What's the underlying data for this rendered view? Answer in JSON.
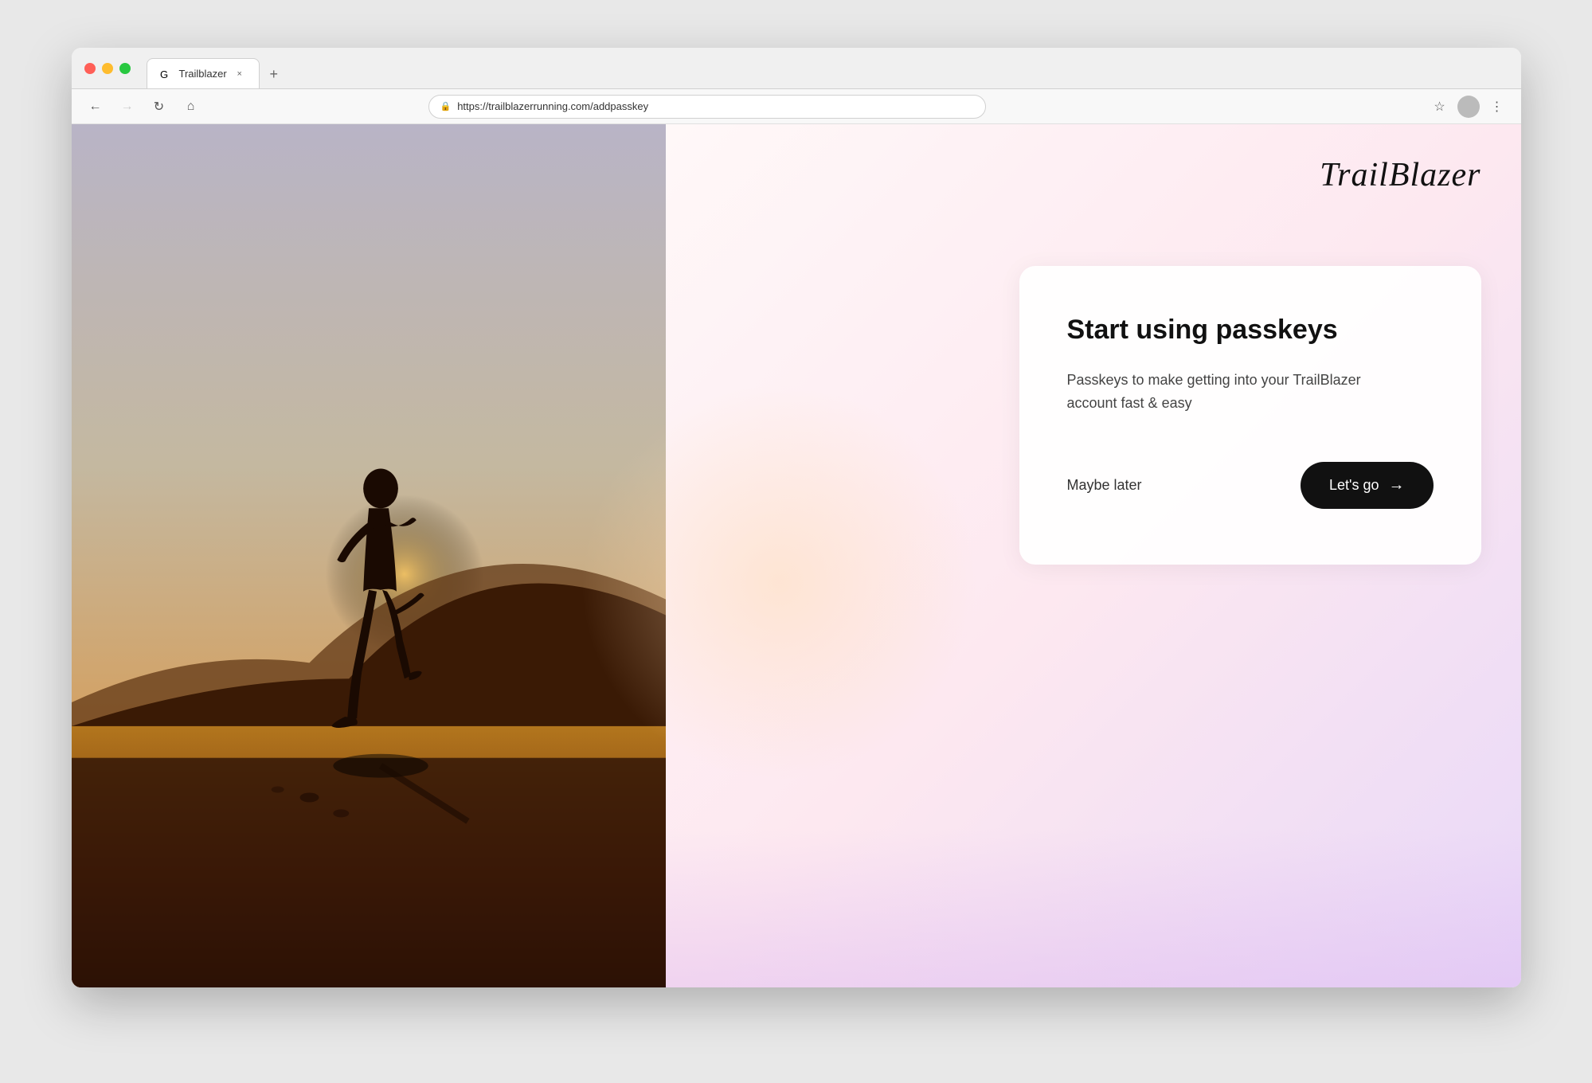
{
  "browser": {
    "tab_title": "Trailblazer",
    "url": "https://trailblazerrunning.com/addpasskey",
    "tab_close_symbol": "×",
    "tab_new_symbol": "+"
  },
  "nav": {
    "back_icon": "←",
    "forward_icon": "→",
    "refresh_icon": "↻",
    "home_icon": "⌂",
    "lock_icon": "🔒",
    "bookmark_icon": "☆",
    "more_icon": "⋮"
  },
  "logo": {
    "text": "TrailBlazer"
  },
  "card": {
    "title": "Start using passkeys",
    "description": "Passkeys to make getting into your TrailBlazer account fast & easy",
    "maybe_later": "Maybe later",
    "lets_go": "Let's go",
    "arrow": "→"
  }
}
